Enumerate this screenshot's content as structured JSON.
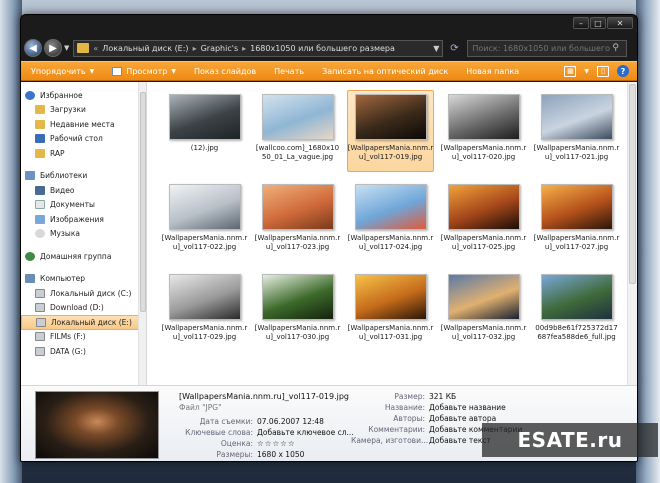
{
  "address": {
    "crumbs": [
      "Локальный диск (E:)",
      "Graphic's",
      "1680x1050 или большего размера"
    ],
    "search_placeholder": "Поиск: 1680x1050 или большего р..."
  },
  "toolbar": {
    "organize": "Упорядочить",
    "view": "Просмотр",
    "slideshow": "Показ слайдов",
    "print": "Печать",
    "burn": "Записать на оптический диск",
    "new_folder": "Новая папка"
  },
  "sidebar": {
    "favorites": {
      "label": "Избранное",
      "items": [
        "Загрузки",
        "Недавние места",
        "Рабочий стол",
        "RAP"
      ]
    },
    "libraries": {
      "label": "Библиотеки",
      "items": [
        "Видео",
        "Документы",
        "Изображения",
        "Музыка"
      ]
    },
    "homegroup": "Домашняя группа",
    "computer": {
      "label": "Компьютер",
      "items": [
        "Локальный диск (C:)",
        "Download (D:)",
        "Локальный диск (E:)",
        "FILMs (F:)",
        "DATA (G:)"
      ]
    }
  },
  "files": [
    {
      "name": "(12).jpg",
      "colors": [
        "#a9b3b8",
        "#3c4246",
        "#1e2326"
      ]
    },
    {
      "name": "[wallcoo.com]_1680x1050_01_La_vague.jpg",
      "colors": [
        "#d3e2ee",
        "#8fb6d4",
        "#e8d6c6"
      ]
    },
    {
      "name": "[WallpapersMania.nnm.ru]_vol117-019.jpg",
      "colors": [
        "#a1673f",
        "#3b2a1a",
        "#0b0907"
      ]
    },
    {
      "name": "[WallpapersMania.nnm.ru]_vol117-020.jpg",
      "colors": [
        "#d8d8d8",
        "#6d6d6d",
        "#1d1d1d"
      ]
    },
    {
      "name": "[WallpapersMania.nnm.ru]_vol117-021.jpg",
      "colors": [
        "#8ea2bc",
        "#c9d4e0",
        "#3b4a5e"
      ]
    },
    {
      "name": "[WallpapersMania.nnm.ru]_vol117-022.jpg",
      "colors": [
        "#f0f2f5",
        "#b8c0c8",
        "#5d6670"
      ]
    },
    {
      "name": "[WallpapersMania.nnm.ru]_vol117-023.jpg",
      "colors": [
        "#f0b07a",
        "#d06a3a",
        "#7a3a1c"
      ]
    },
    {
      "name": "[WallpapersMania.nnm.ru]_vol117-024.jpg",
      "colors": [
        "#c8e0f2",
        "#6fa6d8",
        "#e05a3a"
      ]
    },
    {
      "name": "[WallpapersMania.nnm.ru]_vol117-025.jpg",
      "colors": [
        "#f2a23a",
        "#a4461a",
        "#1a0e08"
      ]
    },
    {
      "name": "[WallpapersMania.nnm.ru]_vol117-027.jpg",
      "colors": [
        "#f6b04a",
        "#b4501a",
        "#2a160c"
      ]
    },
    {
      "name": "[WallpapersMania.nnm.ru]_vol117-029.jpg",
      "colors": [
        "#e8e8e8",
        "#9a9a9a",
        "#2a2a2a"
      ]
    },
    {
      "name": "[WallpapersMania.nnm.ru]_vol117-030.jpg",
      "colors": [
        "#e6eee0",
        "#3c6a2a",
        "#14220e"
      ]
    },
    {
      "name": "[WallpapersMania.nnm.ru]_vol117-031.jpg",
      "colors": [
        "#f7c24a",
        "#c46a1a",
        "#2a1608"
      ]
    },
    {
      "name": "[WallpapersMania.nnm.ru]_vol117-032.jpg",
      "colors": [
        "#5b7aa8",
        "#e0b070",
        "#1a2030"
      ]
    },
    {
      "name": "00d9b8e61f725372d17687fea588de6_full.jpg",
      "colors": [
        "#7aa7d8",
        "#3f6a3a",
        "#1f3040"
      ]
    }
  ],
  "selected_index": 2,
  "details": {
    "name": "[WallpapersMania.nnm.ru]_vol117-019.jpg",
    "type": "Файл \"JPG\"",
    "left": [
      {
        "k": "Дата съемки:",
        "v": "07.06.2007 12:48"
      },
      {
        "k": "Ключевые слова:",
        "v": "Добавьте ключевое сл..."
      },
      {
        "k": "Оценка:",
        "v": "☆☆☆☆☆"
      },
      {
        "k": "Размеры:",
        "v": "1680 x 1050"
      }
    ],
    "right": [
      {
        "k": "Размер:",
        "v": "321 КБ"
      },
      {
        "k": "Название:",
        "v": "Добавьте название"
      },
      {
        "k": "Авторы:",
        "v": "Добавьте автора"
      },
      {
        "k": "Комментарии:",
        "v": "Добавьте комментарии"
      },
      {
        "k": "Камера, изготови...",
        "v": "Добавьте текст"
      }
    ]
  },
  "watermark": "ESATE.ru"
}
